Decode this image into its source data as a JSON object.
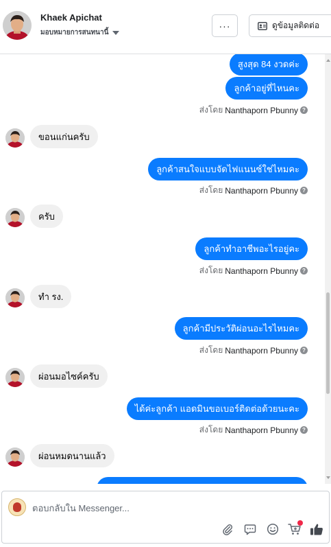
{
  "header": {
    "contact_name": "Khaek Apichat",
    "assign_label": "มอบหมายการสนทนานี้",
    "more_label": "···",
    "contact_info_label": "ดูข้อมูลติดต่อ"
  },
  "messages": [
    {
      "kind": "out",
      "text": "สูงสุด 84 งวดค่ะ"
    },
    {
      "kind": "out",
      "text": "ลูกค้าอยู่ที่ไหนคะ"
    },
    {
      "kind": "sent_by",
      "prefix": "ส่งโดย",
      "name": "Nanthaporn Pbunny"
    },
    {
      "kind": "in",
      "text": "ขอนแก่นครับ"
    },
    {
      "kind": "out",
      "text": "ลูกค้าสนใจแบบจัดไฟแนนซ์ใช่ไหมคะ"
    },
    {
      "kind": "sent_by",
      "prefix": "ส่งโดย",
      "name": "Nanthaporn Pbunny"
    },
    {
      "kind": "in",
      "text": "ครับ"
    },
    {
      "kind": "out",
      "text": "ลูกค้าทำอาชีพอะไรอยู่คะ"
    },
    {
      "kind": "sent_by",
      "prefix": "ส่งโดย",
      "name": "Nanthaporn Pbunny"
    },
    {
      "kind": "in",
      "text": "ทำ รง."
    },
    {
      "kind": "out",
      "text": "ลูกค้ามีประวัติผ่อนอะไรไหมคะ"
    },
    {
      "kind": "sent_by",
      "prefix": "ส่งโดย",
      "name": "Nanthaporn Pbunny"
    },
    {
      "kind": "in",
      "text": "ผ่อนมอไซค์ครับ"
    },
    {
      "kind": "out",
      "text": "ได้ค่ะลูกค้า แอดมินขอเบอร์ติดต่อด้วยนะคะ"
    },
    {
      "kind": "sent_by",
      "prefix": "ส่งโดย",
      "name": "Nanthaporn Pbunny"
    },
    {
      "kind": "in",
      "text": "ผ่อนหมดนานแล้ว"
    }
  ],
  "composer": {
    "placeholder": "ตอบกลับใน Messenger...",
    "icons": [
      "paperclip-icon",
      "chat-bubble-icon",
      "emoji-icon",
      "cart-icon",
      "thumbs-up-icon"
    ]
  },
  "colors": {
    "outgoing_bubble": "#0a7cff",
    "incoming_bubble": "#f0f0f0",
    "badge": "#f02849"
  }
}
